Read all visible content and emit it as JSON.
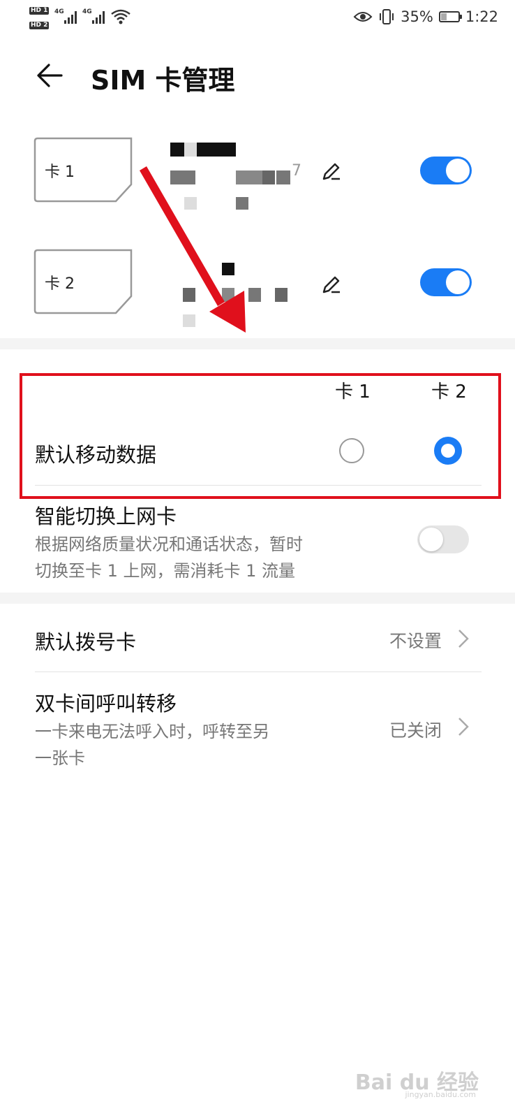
{
  "status_bar": {
    "hd1": "HD 1",
    "hd2": "HD 2",
    "sim1_network": "4G",
    "sim2_network": "4G",
    "battery": "35%",
    "battery_level": 0.35,
    "time": "1:22",
    "icons": [
      "wifi-icon",
      "eye-comfort-icon",
      "vibrate-icon",
      "battery-icon"
    ]
  },
  "header": {
    "title": "SIM 卡管理",
    "back_icon": "arrow-left-icon"
  },
  "sim_cards": [
    {
      "label": "卡 1",
      "name_fragment": "7",
      "enabled": true,
      "edit_icon": "pencil-icon"
    },
    {
      "label": "卡 2",
      "enabled": true,
      "edit_icon": "pencil-icon"
    }
  ],
  "default_data": {
    "col1": "卡 1",
    "col2": "卡 2",
    "title": "默认移动数据",
    "selected": "卡 2"
  },
  "smart_switch": {
    "title": "智能切换上网卡",
    "desc_line1": "根据网络质量状况和通话状态，暂时",
    "desc_line2": "切换至卡 1 上网，需消耗卡 1 流量",
    "enabled": false
  },
  "default_dial": {
    "title": "默认拨号卡",
    "value": "不设置"
  },
  "call_forward": {
    "title": "双卡间呼叫转移",
    "desc_line1": "一卡来电无法呼入时，呼转至另",
    "desc_line2": "一张卡",
    "value": "已关闭"
  },
  "watermark": {
    "text": "Bai du 经验",
    "sub": "jingyan.baidu.com"
  },
  "colors": {
    "accent": "#1a7cf5",
    "annotation_red": "#e0101c"
  }
}
